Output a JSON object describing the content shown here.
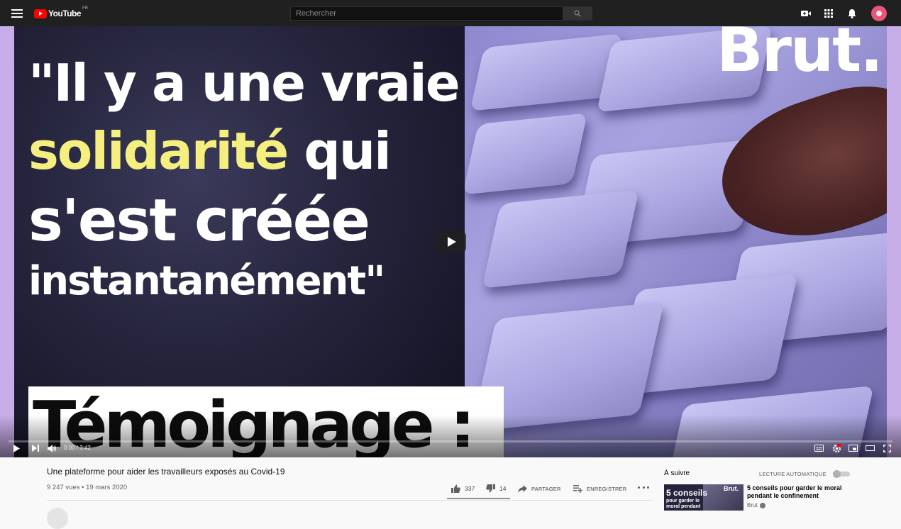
{
  "masthead": {
    "logo_text": "YouTube",
    "region": "FR",
    "search_placeholder": "Rechercher",
    "icons": [
      "menu-icon",
      "search-icon",
      "create-video-icon",
      "apps-grid-icon",
      "notifications-bell-icon",
      "avatar"
    ]
  },
  "video": {
    "headline": {
      "line1": "\"Il y a une vraie",
      "line2_highlight": "solidarité",
      "line2_rest": " qui",
      "line3": "s'est créée",
      "line4": "instantanément\""
    },
    "brand_mark": "Brut.",
    "banner": "Témoignage :",
    "accent_yellow": "#f4ef7e"
  },
  "player": {
    "time": "0:00 / 3:42",
    "progress": 0,
    "progress_color": "#ff0000"
  },
  "info": {
    "title": "Une plateforme pour aider les travailleurs exposés au Covid-19",
    "meta": "9 247 vues • 19 mars 2020",
    "likes": "337",
    "dislikes": "14",
    "share_label": "PARTAGER",
    "save_label": "ENREGISTRER"
  },
  "sidebar": {
    "up_next": "À suivre",
    "autoplay_label": "LECTURE AUTOMATIQUE",
    "autoplay_on": false,
    "recommendation": {
      "thumb_line1": "5 conseils",
      "thumb_line2": "pour garder le moral pendant",
      "thumb_brand": "Brut.",
      "title": "5 conseils pour garder le moral pendant le confinement",
      "channel": "Brut"
    }
  }
}
